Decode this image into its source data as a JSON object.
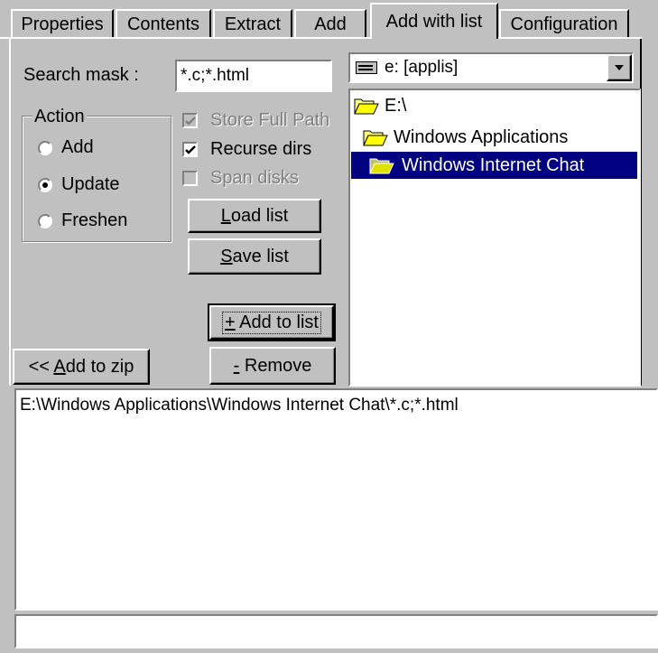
{
  "tabs": [
    {
      "label": "Properties"
    },
    {
      "label": "Contents"
    },
    {
      "label": "Extract"
    },
    {
      "label": "Add"
    },
    {
      "label": "Add with list"
    },
    {
      "label": "Configuration"
    }
  ],
  "search": {
    "label": "Search mask :",
    "value": "*.c;*.html"
  },
  "action": {
    "legend": "Action",
    "options": [
      {
        "label": "Add",
        "checked": false
      },
      {
        "label": "Update",
        "checked": true
      },
      {
        "label": "Freshen",
        "checked": false
      }
    ]
  },
  "options": {
    "store_full_path": {
      "label": "Store Full Path",
      "checked": true,
      "enabled": false
    },
    "recurse_dirs": {
      "label": "Recurse dirs",
      "checked": true,
      "enabled": true
    },
    "span_disks": {
      "label": "Span disks",
      "checked": false,
      "enabled": false
    }
  },
  "buttons": {
    "load_list": {
      "accel": "L",
      "rest": "oad list"
    },
    "save_list": {
      "accel": "S",
      "rest": "ave list"
    },
    "add_to_list": {
      "accel": "+",
      "rest": " Add to list"
    },
    "add_to_zip": {
      "prefix": "<< ",
      "accel": "A",
      "rest": "dd to zip"
    },
    "remove": {
      "accel": "-",
      "rest": " Remove"
    }
  },
  "drive": {
    "value": "e: [applis]"
  },
  "tree": [
    {
      "label": "E:\\",
      "selected": false
    },
    {
      "label": "Windows Applications",
      "selected": false
    },
    {
      "label": "Windows Internet Chat",
      "selected": true
    }
  ],
  "list": {
    "items": [
      "E:\\Windows Applications\\Windows Internet Chat\\*.c;*.html"
    ]
  },
  "status": {
    "text": ""
  }
}
